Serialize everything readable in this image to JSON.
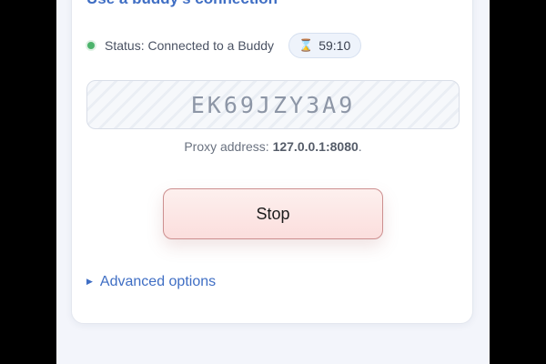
{
  "section": {
    "title": "Use a buddy's connection"
  },
  "status": {
    "text": "Status: Connected to a Buddy",
    "dot_color": "#4cb36b",
    "timer_icon": "hourglass-icon",
    "timer": "59:10"
  },
  "code": {
    "value": "EK69JZY3A9"
  },
  "proxy": {
    "label": "Proxy address: ",
    "address": "127.0.0.1:8080",
    "suffix": "."
  },
  "actions": {
    "stop_label": "Stop"
  },
  "advanced": {
    "icon": "triangle-right-icon",
    "label": "Advanced options"
  },
  "colors": {
    "accent": "#3f6ec4",
    "stop_border": "#cc8f8f",
    "stop_fill": "#fbdedd"
  }
}
